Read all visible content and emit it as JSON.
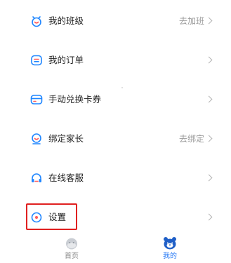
{
  "colors": {
    "accent_blue": "#2b7cf5",
    "icon_blue": "#1f86ff",
    "highlight_red": "#e02020",
    "secondary_text": "#9a9a9a",
    "inactive_tab": "#8a8a8a"
  },
  "menu": {
    "items": [
      {
        "key": "class",
        "label": "我的班级",
        "right_text": "去加班",
        "icon": "class-icon"
      },
      {
        "key": "orders",
        "label": "我的订单",
        "right_text": "",
        "icon": "order-icon"
      },
      {
        "key": "redeem",
        "label": "手动兑换卡券",
        "right_text": "",
        "icon": "card-icon"
      },
      {
        "key": "parent",
        "label": "绑定家长",
        "right_text": "去绑定",
        "icon": "parent-icon"
      },
      {
        "key": "service",
        "label": "在线客服",
        "right_text": "",
        "icon": "headset-icon"
      },
      {
        "key": "settings",
        "label": "设置",
        "right_text": "",
        "icon": "settings-icon"
      }
    ]
  },
  "tabbar": {
    "home_label": "首页",
    "mine_label": "我的",
    "active": "mine"
  }
}
